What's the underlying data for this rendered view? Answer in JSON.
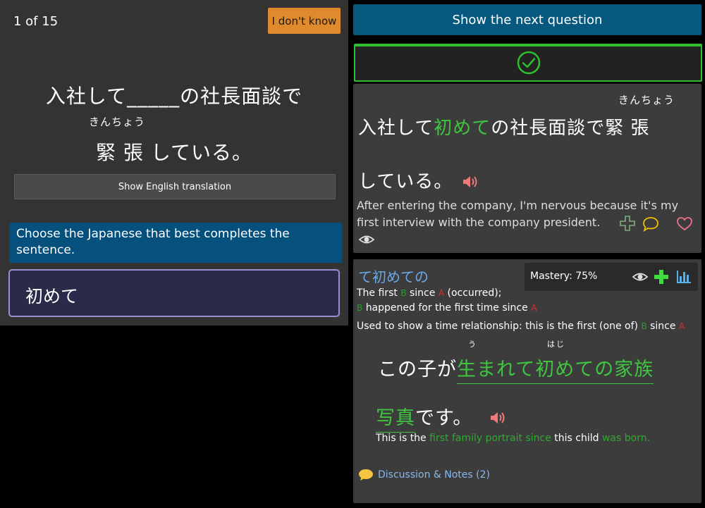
{
  "left": {
    "counter": "1 of 15",
    "dont_know_label": "I don't know",
    "question_line1": "入社して_____の社長面談で",
    "question_furigana": "きんちょう",
    "question_line2": "緊 張 している。",
    "translate_label": "Show English translation",
    "prompt": "Choose the Japanese that best completes the sentence.",
    "selected_answer": "初めて"
  },
  "right": {
    "next_label": "Show the next question",
    "result_icon": "check-circle-icon",
    "sentence": {
      "furigana": "きんちょう",
      "line1_before": "入社して",
      "line1_highlight": "初めて",
      "line1_after": "の社長面談で緊 張",
      "line2": "している。",
      "english": "After entering the company, I'm nervous because it's my first interview with the company president."
    },
    "grammar": {
      "title": "て初めての",
      "mastery": "Mastery: 75%",
      "def1_a": "The first",
      "def1_b": "since",
      "def1_c": "(occurred);",
      "def2": "happened for the first time since",
      "usage": "Used to show a time relationship: this is the first (one of)",
      "usage_b": "since",
      "marker_a": "A",
      "marker_b": "B",
      "furigana_u": "う",
      "furigana_hajime": "はじ",
      "example_prefix": "この子が",
      "example_highlight1": "生まれて初めての家族",
      "example_highlight2": "写真",
      "example_suffix": "です。",
      "example_en_1": "This is the",
      "example_en_2": "first family portrait since",
      "example_en_3": "this child",
      "example_en_4": "was born.",
      "discussion": "Discussion & Notes (2)"
    }
  },
  "colors": {
    "accent_orange": "#e08a2e",
    "accent_blue": "#06587e",
    "highlight_green": "#3fc53f",
    "marker_red": "#d43030",
    "link_blue": "#8ab8ea"
  }
}
